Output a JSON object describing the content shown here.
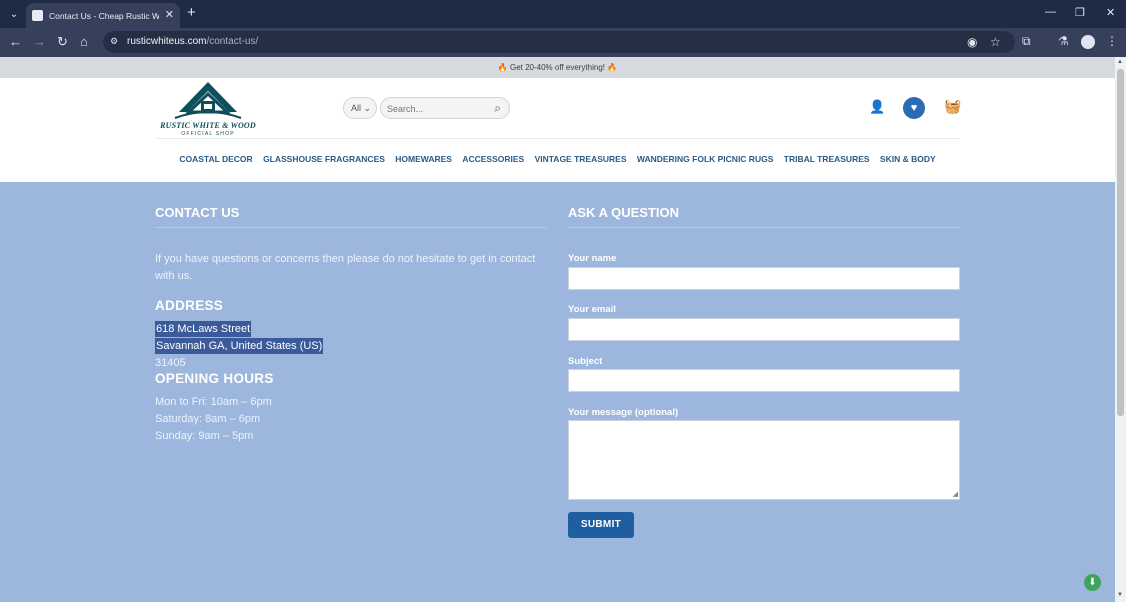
{
  "browser": {
    "tab_title": "Contact Us - Cheap Rustic White",
    "tab_close": "✕",
    "new_tab": "+",
    "url_domain": "rusticwhiteus.com",
    "url_path": "/contact-us/",
    "window_minimize": "—",
    "window_restore": "❐",
    "window_close": "✕"
  },
  "promo": {
    "text": "🔥 Get 20-40% off everything! 🔥"
  },
  "header": {
    "logo_title": "RUSTIC WHITE & WOOD",
    "logo_subtitle": "OFFICIAL SHOP",
    "category_select": "All",
    "search_placeholder": "Search..."
  },
  "nav": {
    "items": [
      "COASTAL DECOR",
      "GLASSHOUSE FRAGRANCES",
      "HOMEWARES",
      "ACCESSORIES",
      "VINTAGE TREASURES",
      "WANDERING FOLK PICNIC RUGS",
      "TRIBAL TREASURES",
      "SKIN & BODY"
    ]
  },
  "contact": {
    "heading": "CONTACT US",
    "intro": "If you have questions or concerns then please do not hesitate to get in contact with us.",
    "address_heading": "ADDRESS",
    "address_lines": [
      "618 McLaws Street",
      "Savannah GA, United States (US)",
      "31405"
    ],
    "hours_heading": "OPENING HOURS",
    "hours": [
      "Mon to Fri: 10am – 6pm",
      "Saturday: 8am – 6pm",
      "Sunday: 9am – 5pm"
    ]
  },
  "form": {
    "heading": "ASK A QUESTION",
    "name_label": "Your name",
    "email_label": "Your email",
    "subject_label": "Subject",
    "message_label": "Your message (optional)",
    "submit_label": "SUBMIT"
  },
  "colors": {
    "page_bg": "#9db6de",
    "accent": "#1f5e9f",
    "nav_text": "#2a5a88"
  }
}
